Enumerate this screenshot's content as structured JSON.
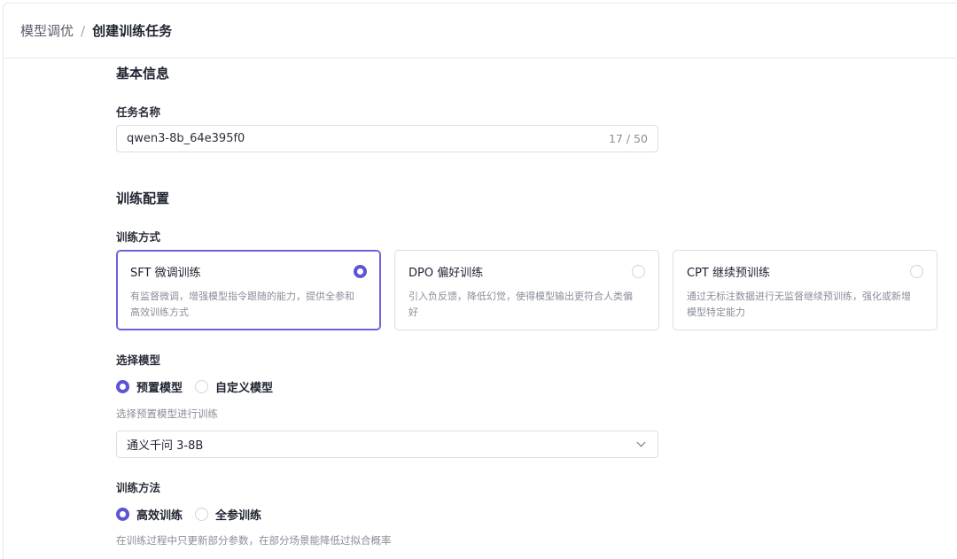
{
  "breadcrumb": {
    "parent": "模型调优",
    "separator": "/",
    "current": "创建训练任务"
  },
  "basic": {
    "title": "基本信息",
    "task_name_label": "任务名称",
    "task_name_value": "qwen3-8b_64e395f0",
    "task_name_counter": "17 / 50"
  },
  "config": {
    "title": "训练配置",
    "mode_label": "训练方式",
    "modes": [
      {
        "title": "SFT 微调训练",
        "desc": "有监督微调，增强模型指令跟随的能力，提供全参和高效训练方式",
        "selected": true
      },
      {
        "title": "DPO 偏好训练",
        "desc": "引入负反馈，降低幻觉，使得模型输出更符合人类偏好",
        "selected": false
      },
      {
        "title": "CPT 继续预训练",
        "desc": "通过无标注数据进行无监督继续预训练，强化或新增模型特定能力",
        "selected": false
      }
    ],
    "model_label": "选择模型",
    "model_options": [
      {
        "label": "预置模型",
        "selected": true
      },
      {
        "label": "自定义模型",
        "selected": false
      }
    ],
    "model_hint": "选择预置模型进行训练",
    "model_select_value": "通义千问 3-8B",
    "method_label": "训练方法",
    "method_options": [
      {
        "label": "高效训练",
        "selected": true
      },
      {
        "label": "全参训练",
        "selected": false
      }
    ],
    "method_hint": "在训练过程中只更新部分参数，在部分场景能降低过拟合概率"
  },
  "colors": {
    "accent": "#5b55d6",
    "border": "#dcdee4",
    "muted": "#8a8e99"
  }
}
